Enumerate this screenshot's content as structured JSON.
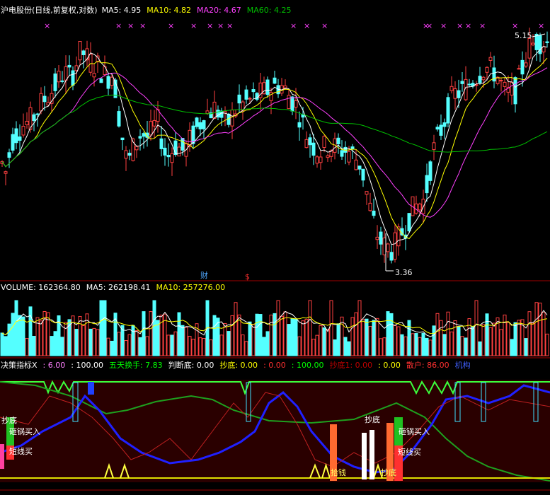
{
  "price_panel": {
    "title": "沪电股份(日线,前复权,对数)",
    "ma_labels": [
      {
        "text": "MA5: 4.95",
        "color": "#ffffff"
      },
      {
        "text": "MA10: 4.82",
        "color": "#ffff00"
      },
      {
        "text": "MA20: 4.67",
        "color": "#ff40ff"
      },
      {
        "text": "MA60: 4.25",
        "color": "#00c000"
      }
    ],
    "high_label": "5.15",
    "low_label": "3.36",
    "marker_cai": "财",
    "marker_s": "$",
    "x_marks": "×"
  },
  "volume_panel": {
    "labels": [
      {
        "text": "VOLUME: 162364.80",
        "color": "#ffffff"
      },
      {
        "text": "MA5: 262198.41",
        "color": "#ffffff"
      },
      {
        "text": "MA10: 257276.00",
        "color": "#ffff00"
      }
    ]
  },
  "indicator_panel": {
    "labels": [
      {
        "text": "决策指标X",
        "color": "#ffffff"
      },
      {
        "text": ": 6.00",
        "color": "#ff80ff"
      },
      {
        "text": ": 100.00",
        "color": "#ffffff"
      },
      {
        "text": "五天换手: 7.83",
        "color": "#00ff00"
      },
      {
        "text": "判断底: 0.00",
        "color": "#ffffff"
      },
      {
        "text": "抄底: 0.00",
        "color": "#ffff00"
      },
      {
        "text": ": 0.00",
        "color": "#ff3030"
      },
      {
        "text": ": 100.00",
        "color": "#00ff00"
      },
      {
        "text": "抄底1: 0.00",
        "color": "#c00000"
      },
      {
        "text": ": 0.00",
        "color": "#ffff00"
      },
      {
        "text": "散户: 86.00",
        "color": "#ff3030"
      },
      {
        "text": "机构",
        "color": "#4060ff"
      }
    ],
    "signals": {
      "zagou1": "砸锅买入",
      "duanxian1": "短线买",
      "chaodi_left": "抄底",
      "chaodi": "抄底",
      "zagou2": "砸锅买入",
      "duanxian2": "短线买",
      "shiqian": "拾钱",
      "chaodi_bottom": "抄底"
    }
  },
  "chart_data": [
    {
      "type": "candlestick",
      "title": "沪电股份(日线,前复权,对数)",
      "scale": "log",
      "ylim": [
        3.36,
        5.15
      ],
      "annotations": [
        "5.15",
        "3.36",
        "财",
        "$"
      ],
      "legend": [
        "MA5: 4.95",
        "MA10: 4.82",
        "MA20: 4.67",
        "MA60: 4.25"
      ]
    },
    {
      "type": "bar",
      "title": "VOLUME",
      "legend": [
        "VOLUME: 162364.80",
        "MA5: 262198.41",
        "MA10: 257276.00"
      ]
    },
    {
      "type": "line",
      "title": "决策指标X",
      "ylim": [
        0,
        100
      ]
    }
  ]
}
